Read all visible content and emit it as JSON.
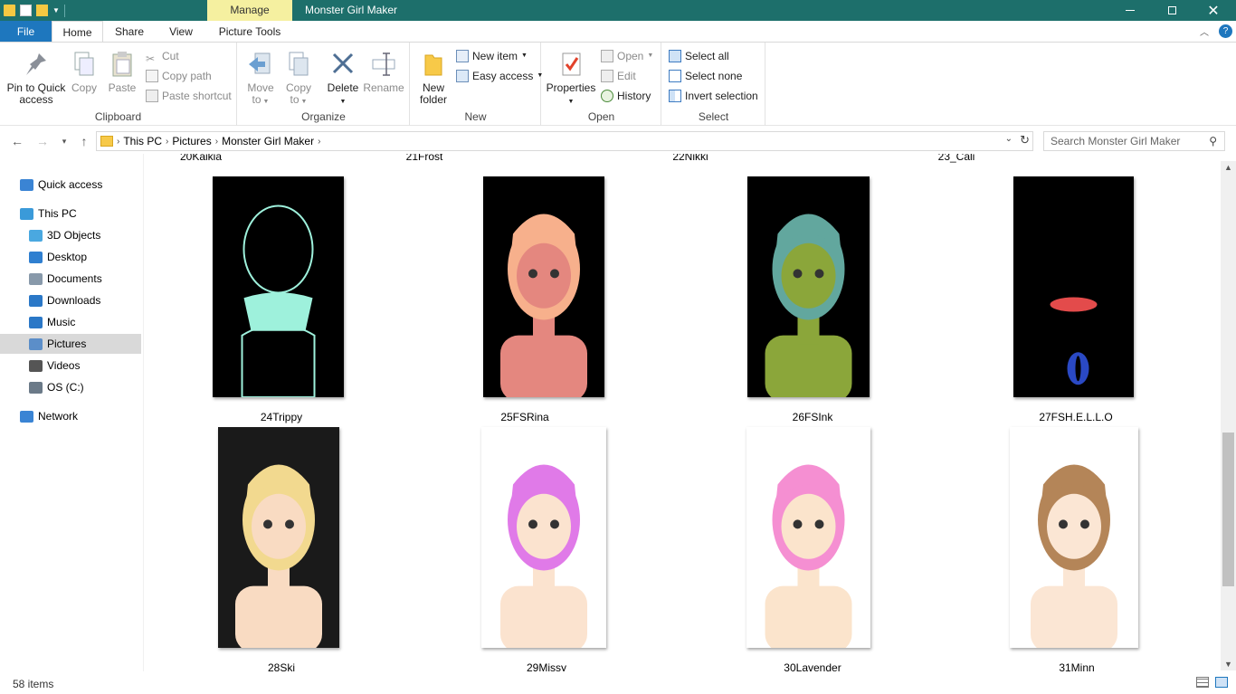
{
  "window": {
    "title": "Monster Girl Maker",
    "context_tab": "Manage"
  },
  "tabs": {
    "file": "File",
    "home": "Home",
    "share": "Share",
    "view": "View",
    "picture_tools": "Picture Tools"
  },
  "ribbon": {
    "clipboard": {
      "label": "Clipboard",
      "pin_line1": "Pin to Quick",
      "pin_line2": "access",
      "copy": "Copy",
      "paste": "Paste",
      "cut": "Cut",
      "copy_path": "Copy path",
      "paste_shortcut": "Paste shortcut"
    },
    "organize": {
      "label": "Organize",
      "move_line1": "Move",
      "move_line2": "to",
      "copy_line1": "Copy",
      "copy_line2": "to",
      "delete": "Delete",
      "rename": "Rename"
    },
    "new": {
      "label": "New",
      "new_folder_line1": "New",
      "new_folder_line2": "folder",
      "new_item": "New item",
      "easy_access": "Easy access"
    },
    "open": {
      "label": "Open",
      "properties": "Properties",
      "open": "Open",
      "edit": "Edit",
      "history": "History"
    },
    "select": {
      "label": "Select",
      "select_all": "Select all",
      "select_none": "Select none",
      "invert_selection": "Invert selection"
    }
  },
  "address": {
    "segments": [
      "This PC",
      "Pictures",
      "Monster Girl Maker"
    ],
    "search_placeholder": "Search Monster Girl Maker"
  },
  "nav_pane": [
    {
      "label": "Quick access",
      "icon": "star-icon"
    },
    {
      "label": "This PC",
      "icon": "computer-icon"
    },
    {
      "label": "3D Objects",
      "icon": "cube-icon"
    },
    {
      "label": "Desktop",
      "icon": "desktop-icon"
    },
    {
      "label": "Documents",
      "icon": "document-icon"
    },
    {
      "label": "Downloads",
      "icon": "download-icon"
    },
    {
      "label": "Music",
      "icon": "music-icon"
    },
    {
      "label": "Pictures",
      "icon": "pictures-icon",
      "selected": true
    },
    {
      "label": "Videos",
      "icon": "film-icon"
    },
    {
      "label": "OS (C:)",
      "icon": "drive-icon"
    },
    {
      "label": "Network",
      "icon": "network-icon"
    }
  ],
  "partial_captions": [
    "20Kaikia",
    "21Frost",
    "22Nikki",
    "23_Cali"
  ],
  "files": [
    {
      "name": "24Trippy",
      "bg": "#000000",
      "hair": "#9ef1dc",
      "skin": "#000000"
    },
    {
      "name": "25FSRina",
      "bg": "#000000",
      "hair": "#f7b08c",
      "skin": "#e4877f"
    },
    {
      "name": "26FSInk",
      "bg": "#000000",
      "hair": "#62a79e",
      "skin": "#8ba63a"
    },
    {
      "name": "27FSH.E.L.L.O",
      "bg": "#000000",
      "hair": "#000000",
      "skin": "#000000"
    },
    {
      "name": "28Ski",
      "bg": "#1a1a1a",
      "hair": "#f2d98f",
      "skin": "#f9dbc2"
    },
    {
      "name": "29Missy",
      "bg": "#ffffff",
      "hair": "#e07ae8",
      "skin": "#fbe3cf"
    },
    {
      "name": "30Lavender",
      "bg": "#ffffff",
      "hair": "#f58fd2",
      "skin": "#fbe4cc"
    },
    {
      "name": "31Minn",
      "bg": "#ffffff",
      "hair": "#b48558",
      "skin": "#fbe6d4"
    }
  ],
  "status": {
    "count": "58 items"
  }
}
